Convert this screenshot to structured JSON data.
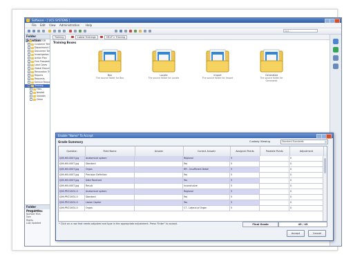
{
  "window": {
    "title": "Software - [ UCS SYSTEMS ]",
    "menu": [
      "File",
      "Edit",
      "View",
      "Administration",
      "Help"
    ],
    "search_placeholder": "Find..."
  },
  "sidebar": {
    "title": "Folder Selection",
    "items": [
      {
        "label": "COLLECTOR",
        "level": 0
      },
      {
        "label": "Customer Templates",
        "level": 1
      },
      {
        "label": "Department Case Forms",
        "level": 1
      },
      {
        "label": "Document Templates (Admin Only)",
        "level": 1
      },
      {
        "label": "Investigation Services",
        "level": 1
      },
      {
        "label": "Action Plan",
        "level": 1
      },
      {
        "label": "Firm Prospects",
        "level": 1
      },
      {
        "label": "Lead Cases",
        "level": 1
      },
      {
        "label": "Global Documentation",
        "level": 1
      },
      {
        "label": "Renovation Tracking",
        "level": 1
      },
      {
        "label": "Reports",
        "level": 1
      },
      {
        "label": "Requests",
        "level": 1
      },
      {
        "label": "Service Requests",
        "level": 1
      },
      {
        "label": "Training",
        "level": 1,
        "selected": true
      },
      {
        "label": "Files",
        "level": 2
      },
      {
        "label": "Nested",
        "level": 2
      },
      {
        "label": "Uploads",
        "level": 2
      },
      {
        "label": "Other",
        "level": 2
      }
    ],
    "properties_title": "Folder Properties",
    "properties": [
      "Owner Name",
      "Number Files",
      "Size",
      "Rights",
      "Last Updated"
    ]
  },
  "content": {
    "breadcrumb": [
      "Training",
      "Latest Trainings",
      "HELP > Training"
    ],
    "section_title": "Training Boxes",
    "boxes": [
      {
        "name": "Box",
        "desc": "The source folder for Box"
      },
      {
        "name": "Locate",
        "desc": "The source folder for Locate"
      },
      {
        "name": "Import",
        "desc": "The source folder for Import"
      },
      {
        "name": "Generated",
        "desc": "The source folder for Generated"
      }
    ]
  },
  "dialog": {
    "title": "Enable \"Name\" To Accept",
    "heading": "Grade Summary",
    "library_label": "Custody Viewing",
    "library_value": "Standard Standards",
    "columns": [
      "Question",
      "Field Name",
      "Answer",
      "Correct Answer",
      "Assigned Points",
      "Possible Points",
      "Adjustment"
    ],
    "rows": [
      [
        "Q09-HIV-0007.jpg",
        "Anatomical system",
        "",
        "Regional",
        "5",
        "",
        "0"
      ],
      [
        "Q09-HIV-0007.jpg",
        "Standard",
        "",
        "Yes",
        "5",
        "",
        "0"
      ],
      [
        "Q09-HIV-0007.jpg",
        "Organ",
        "",
        "RFI - Insufficient Detail",
        "5",
        "",
        "0"
      ],
      [
        "Q09-HIV-0007.jpg",
        "Precision Definition",
        "",
        "Yes",
        "5",
        "",
        "0"
      ],
      [
        "Q09-HIV-0007.jpg",
        "Date Received",
        "",
        "Yes",
        "5",
        "",
        "0"
      ],
      [
        "Q09-HIV-0007.jpg",
        "Result",
        "",
        "Inconclusive",
        "5",
        "",
        "0"
      ],
      [
        "Q09-PR-T-0001-0",
        "Anatomical system",
        "",
        "Regional",
        "5",
        "",
        "0"
      ],
      [
        "Q09-PR-T-0001-0",
        "Standard",
        "",
        "Yes",
        "5",
        "",
        "0"
      ],
      [
        "Q09-PR-T-0001-0",
        "Lesion Capital",
        "",
        "Yes",
        "5",
        "",
        "0"
      ],
      [
        "Q09-PR-T-0001-0",
        "Organ",
        "",
        "C7 - Lateral of Organ",
        "5",
        "",
        "0"
      ]
    ],
    "note": "* Click on a row that needs adjusted and type in the appropriate adjustment. Press \"Enter\" to accept.",
    "total_label": "Final Grade",
    "total_value": "45 / 45",
    "accept_label": "Accept",
    "cancel_label": "Cancel"
  }
}
